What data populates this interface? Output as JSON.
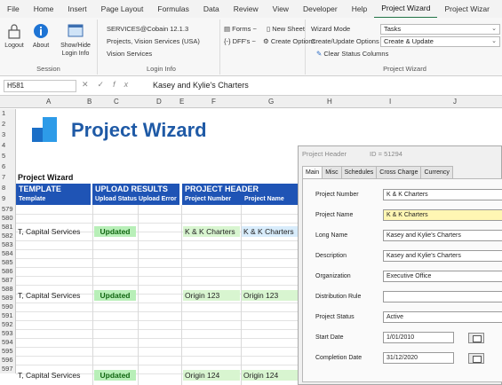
{
  "ribbon_tabs": [
    "File",
    "Home",
    "Insert",
    "Page Layout",
    "Formulas",
    "Data",
    "Review",
    "View",
    "Developer",
    "Help",
    "Project Wizard",
    "Project Wizar"
  ],
  "ribbon": {
    "session": {
      "logout": "Logout",
      "about": "About",
      "show_hide": "Show/Hide",
      "login_info": "Login Info",
      "group_label": "Session"
    },
    "login_info": {
      "line1": "SERVICES@Cobain 12.1.3",
      "line2": "Projects, Vision Services (USA)",
      "line3": "Vision Services",
      "group_label": "Login Info"
    },
    "forms": {
      "forms": "Forms ~",
      "dffs": "DFF's ~",
      "new_sheet": "New Sheet",
      "create_options": "Create Options"
    },
    "wizard": {
      "mode_label": "Wizard Mode",
      "options_label": "Create/Update Options",
      "clear_status": "Clear Status Columns",
      "mode_value": "Tasks",
      "options_value": "Create & Update",
      "group_label": "Project Wizard"
    }
  },
  "formula_bar": {
    "name_box": "H581",
    "fx": "fx",
    "value": "Kasey and Kylie's Charters"
  },
  "sheet": {
    "columns": [
      "A",
      "B",
      "C",
      "D",
      "E",
      "F",
      "G",
      "H",
      "I",
      "J"
    ],
    "rows_top": [
      "1",
      "2",
      "3",
      "4",
      "5",
      "6",
      "7",
      "8",
      "9"
    ],
    "rows_data": [
      "579",
      "580",
      "581",
      "582",
      "583",
      "584",
      "585",
      "586",
      "587",
      "588",
      "589",
      "590",
      "591",
      "592",
      "593",
      "594",
      "595",
      "596",
      "597"
    ],
    "big_title": "Project Wizard",
    "sheet_title": "Project Wizard",
    "bands": {
      "template": "TEMPLATE",
      "template_sub": "Template",
      "upload": "UPLOAD RESULTS",
      "upload_status": "Upload Status",
      "upload_error": "Upload Error",
      "project_header": "PROJECT HEADER",
      "project_number": "Project Number",
      "project_name": "Project Name"
    },
    "data_rows": [
      {
        "template": "T, Capital Services",
        "status": "Updated",
        "number": "K & K Charters",
        "name": "K & K Charters"
      },
      {
        "template": "T, Capital Services",
        "status": "Updated",
        "number": "Origin 123",
        "name": "Origin 123"
      },
      {
        "template": "T, Capital Services",
        "status": "Updated",
        "number": "Origin 124",
        "name": "Origin 124"
      }
    ]
  },
  "dialog": {
    "title": "Project Header",
    "id_text": "ID = 51294",
    "tabs": [
      "Main",
      "Misc",
      "Schedules",
      "Cross Charge",
      "Currency"
    ],
    "fields": [
      {
        "label": "Project Number",
        "value": "K & K Charters"
      },
      {
        "label": "Project Name",
        "value": "K & K Charters"
      },
      {
        "label": "Long Name",
        "value": "Kasey and Kylie's Charters"
      },
      {
        "label": "Description",
        "value": "Kasey and Kylie's Charters"
      },
      {
        "label": "Organization",
        "value": "Executive Office"
      },
      {
        "label": "Distribution Rule",
        "value": ""
      },
      {
        "label": "Project Status",
        "value": "Active"
      },
      {
        "label": "Start Date",
        "value": "1/01/2010"
      },
      {
        "label": "Completion Date",
        "value": "31/12/2020"
      }
    ]
  },
  "colors": {
    "header_band": "#1f54b5",
    "updated_bg": "#b8efb8",
    "title_blue": "#1f5aa6",
    "active_tab_underline": "#217346"
  }
}
